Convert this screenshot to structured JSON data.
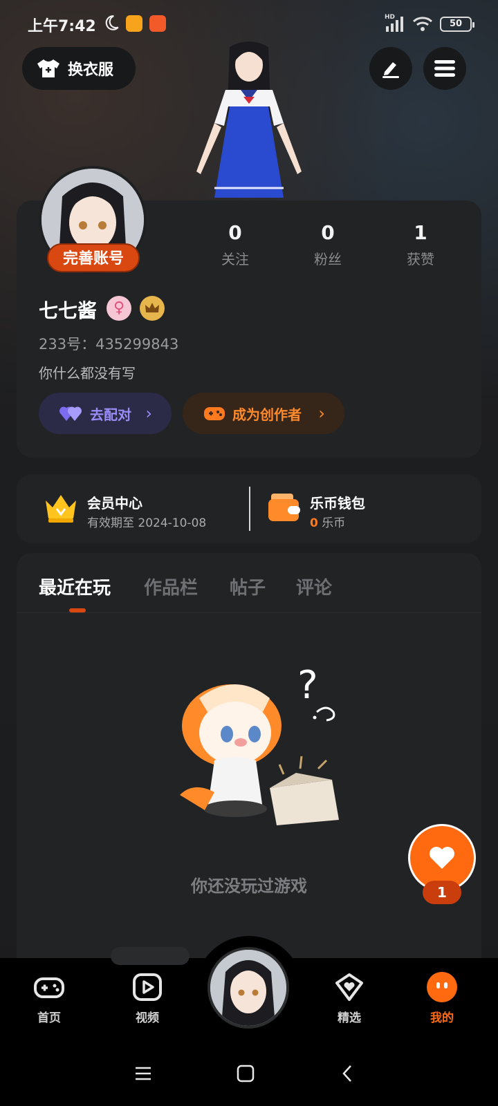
{
  "status_bar": {
    "time": "上午7:42",
    "hd": "HD",
    "battery": "50",
    "icons": [
      "moon-icon",
      "app-notification-icon",
      "app-notification-icon",
      "signal-icon",
      "wifi-icon",
      "battery-icon"
    ]
  },
  "header": {
    "outfit_label": "换衣服",
    "icons": [
      "tshirt-icon",
      "edit-icon",
      "menu-icon"
    ]
  },
  "profile": {
    "complete_account_label": "完善账号",
    "stats": [
      {
        "value": "0",
        "label": "关注"
      },
      {
        "value": "0",
        "label": "粉丝"
      },
      {
        "value": "1",
        "label": "获赞"
      }
    ],
    "name": "七七酱",
    "gender_symbol": "♀",
    "uid": "233号：435299843",
    "bio": "你什么都没有写",
    "match_label": "去配对",
    "creator_label": "成为创作者"
  },
  "membership": {
    "vip_title": "会员中心",
    "vip_expiry": "有效期至 2024-10-08",
    "wallet_title": "乐币钱包",
    "wallet_amount": "0",
    "wallet_unit": "乐币"
  },
  "tabs": [
    {
      "label": "最近在玩",
      "active": true
    },
    {
      "label": "作品栏",
      "active": false
    },
    {
      "label": "帖子",
      "active": false
    },
    {
      "label": "评论",
      "active": false
    }
  ],
  "empty_state": {
    "text": "你还没玩过游戏"
  },
  "like_fab": {
    "count": "1"
  },
  "bottom_nav": [
    {
      "label": "首页",
      "icon": "gamepad-icon"
    },
    {
      "label": "视频",
      "icon": "video-play-icon"
    },
    {
      "label": "精选",
      "icon": "heart-box-icon"
    },
    {
      "label": "我的",
      "icon": "face-icon",
      "active": true
    }
  ],
  "colors": {
    "accent": "#ff6a10",
    "badge_red": "#d94811",
    "match_purple": "#9a8cf7",
    "card_bg": "#222325"
  }
}
